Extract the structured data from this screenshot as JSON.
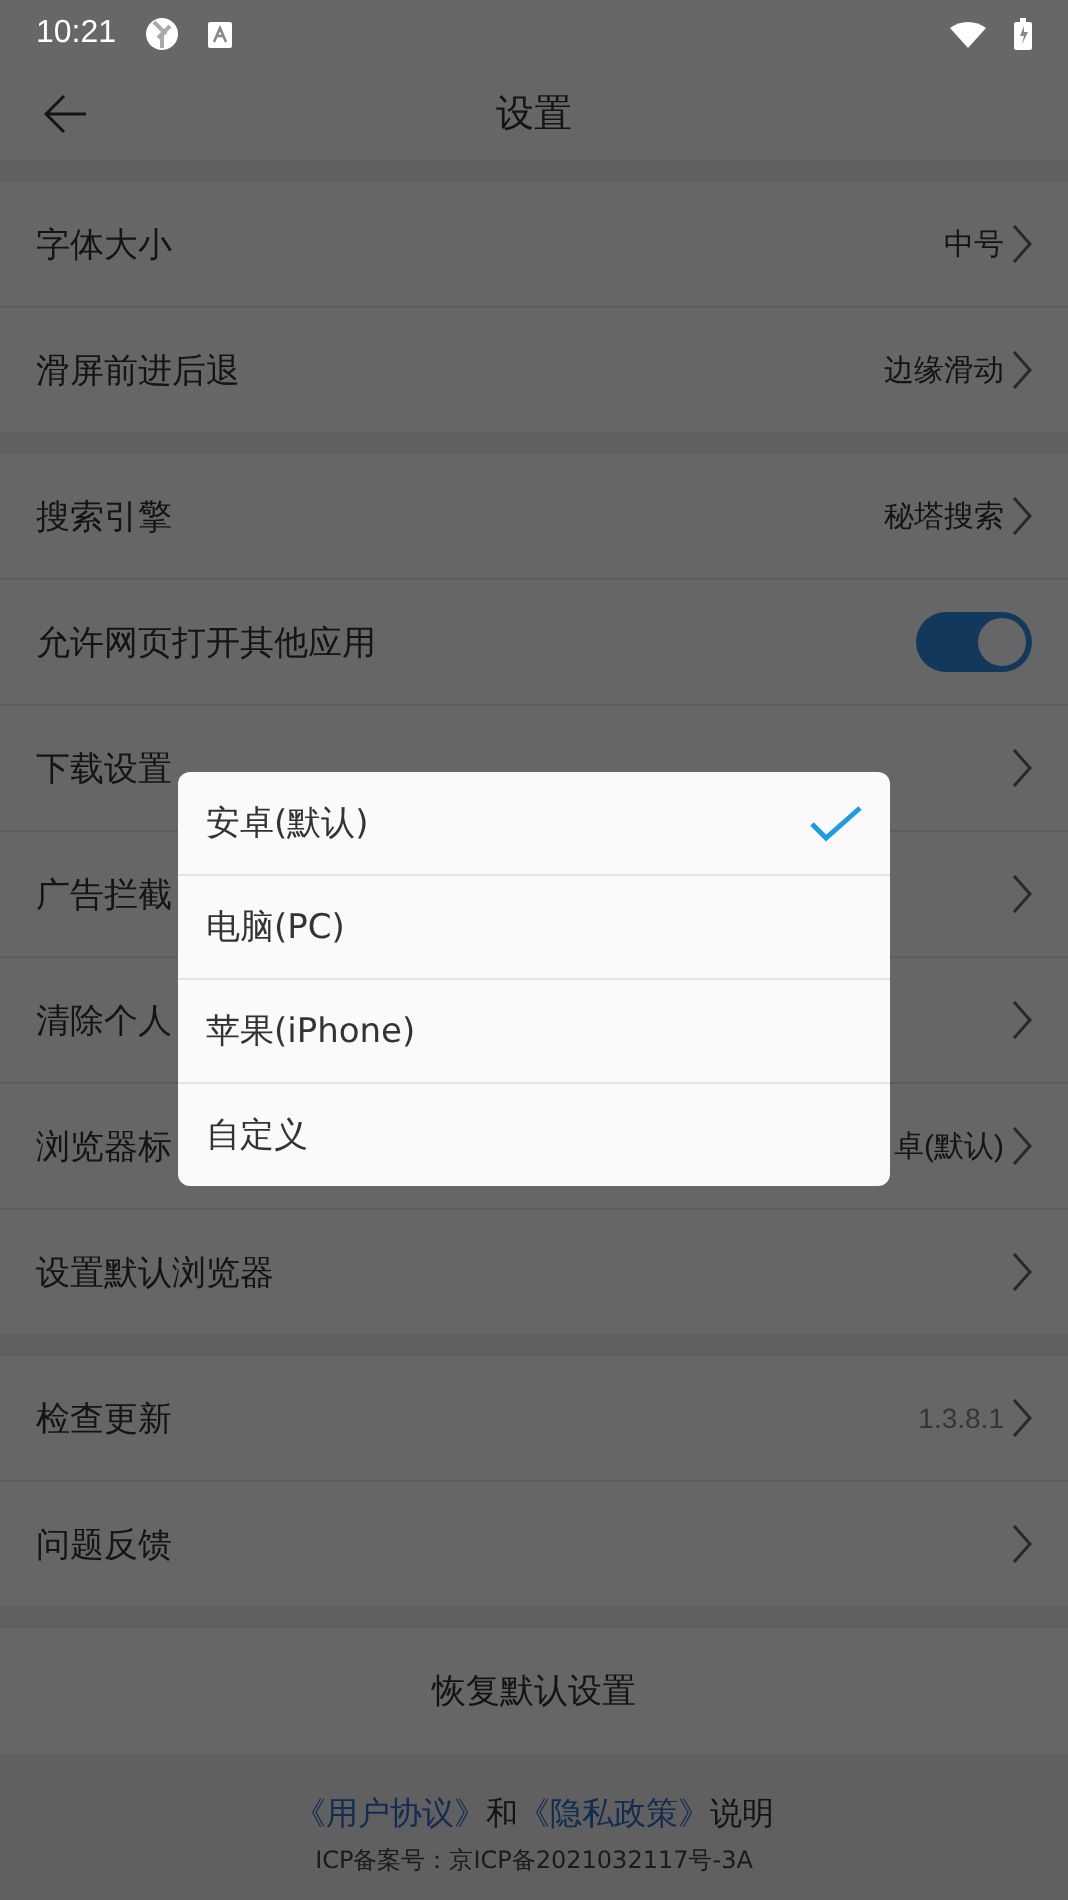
{
  "status_bar": {
    "time": "10:21"
  },
  "header": {
    "title": "设置"
  },
  "groups": [
    [
      {
        "kind": "link",
        "label": "字体大小",
        "value": "中号"
      },
      {
        "kind": "link",
        "label": "滑屏前进后退",
        "value": "边缘滑动"
      }
    ],
    [
      {
        "kind": "link",
        "label": "搜索引擎",
        "value": "秘塔搜索"
      },
      {
        "kind": "toggle",
        "label": "允许网页打开其他应用",
        "on": true
      },
      {
        "kind": "link",
        "label": "下载设置"
      },
      {
        "kind": "link",
        "label": "广告拦截"
      },
      {
        "kind": "link",
        "label": "清除个人"
      },
      {
        "kind": "link",
        "label": "浏览器标",
        "value": "卓(默认)"
      },
      {
        "kind": "link",
        "label": "设置默认浏览器"
      }
    ],
    [
      {
        "kind": "link",
        "label": "检查更新",
        "value": "1.3.8.1",
        "small": true
      },
      {
        "kind": "link",
        "label": "问题反馈"
      }
    ]
  ],
  "restore_button": "恢复默认设置",
  "footer": {
    "agreement_link": "《用户协议》",
    "joiner": "和",
    "privacy_link": "《隐私政策》",
    "suffix": "说明",
    "icp": "ICP备案号：京ICP备2021032117号-3A"
  },
  "dialog": {
    "options": [
      {
        "label": "安卓(默认)",
        "selected": true
      },
      {
        "label": "电脑(PC)",
        "selected": false
      },
      {
        "label": "苹果(iPhone)",
        "selected": false
      },
      {
        "label": "自定义",
        "selected": false
      }
    ]
  }
}
